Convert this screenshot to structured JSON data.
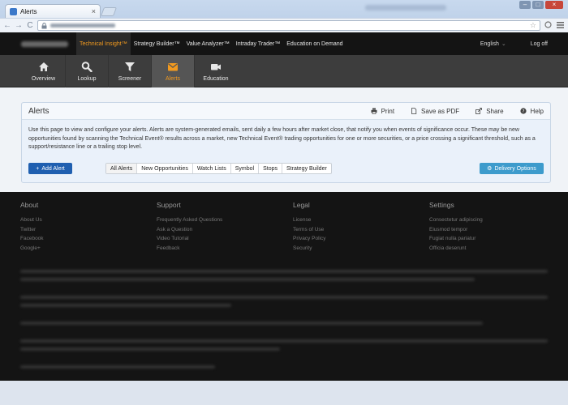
{
  "browser": {
    "tab_title": "Alerts",
    "tab_close": "×",
    "nav_back": "←",
    "nav_forward": "→",
    "nav_reload": "C",
    "omni_star": "☆",
    "controls": {
      "minimize": "–",
      "maximize": "□",
      "close": "×"
    }
  },
  "topnav": {
    "items": [
      "Technical Insight™",
      "Strategy Builder™",
      "Value Analyzer™",
      "Intraday Trader™",
      "Education on Demand"
    ],
    "active_index": 0,
    "language": "English",
    "language_caret": "⌄",
    "logout": "Log off"
  },
  "iconnav": {
    "items": [
      {
        "label": "Overview",
        "icon": "home-icon"
      },
      {
        "label": "Lookup",
        "icon": "search-icon"
      },
      {
        "label": "Screener",
        "icon": "filter-icon"
      },
      {
        "label": "Alerts",
        "icon": "envelope-icon"
      },
      {
        "label": "Education",
        "icon": "video-camera-icon"
      }
    ],
    "active_index": 3,
    "accent": "#f29a1f"
  },
  "panel": {
    "title": "Alerts",
    "actions": {
      "print": "Print",
      "save_pdf": "Save as PDF",
      "share": "Share",
      "help": "Help"
    },
    "description": "Use this page to view and configure your alerts. Alerts are system-generated emails, sent daily a few hours after market close, that notify you when events of significance occur. These may be new opportunities found by scanning the Technical Event® results across a market, new Technical Event® trading opportunities for one or more securities, or a price crossing a significant threshold, such as a support/resistance line or a trailing stop level.",
    "add_alert": "Add Alert",
    "add_alert_icon": "+",
    "filters": [
      "All Alerts",
      "New Opportunities",
      "Watch Lists",
      "Symbol",
      "Stops",
      "Strategy Builder"
    ],
    "active_filter": 0,
    "delivery_options": "Delivery Options",
    "delivery_icon": "⚙",
    "colors": {
      "primary": "#1f5fb0",
      "info": "#3d9bcc"
    }
  },
  "footer": {
    "columns": [
      {
        "title": "About",
        "links": [
          "About Us",
          "Twitter",
          "Facebook",
          "Google+"
        ]
      },
      {
        "title": "Support",
        "links": [
          "Frequently Asked Questions",
          "Ask a Question",
          "Video Tutorial",
          "Feedback"
        ]
      },
      {
        "title": "Legal",
        "links": [
          "License",
          "Terms of Use",
          "Privacy Policy",
          "Security"
        ]
      },
      {
        "title": "Settings",
        "links": [
          "Consectetur adipiscing",
          "Eiusmod tempor",
          "Fugiat nulla pariatur",
          "Officia deserunt"
        ]
      }
    ]
  }
}
